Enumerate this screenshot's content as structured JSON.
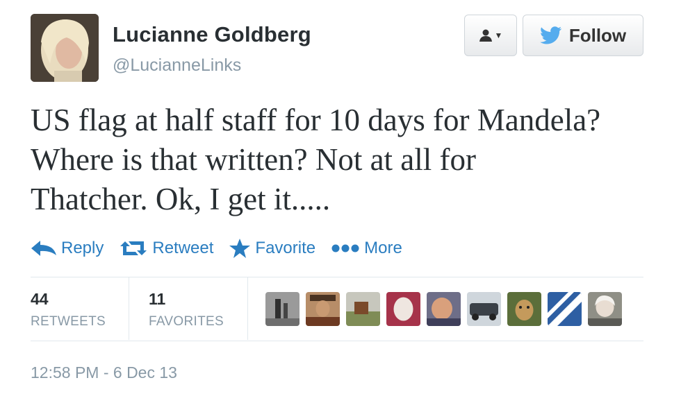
{
  "author": {
    "name": "Lucianne Goldberg",
    "handle": "@LucianneLinks"
  },
  "header": {
    "follow_label": "Follow"
  },
  "tweet": {
    "lines": [
      "US flag at half staff for 10 days for Mandela?",
      "Where is that written? Not at all for",
      "Thatcher. Ok, I get it....."
    ]
  },
  "actions": {
    "reply": "Reply",
    "retweet": "Retweet",
    "favorite": "Favorite",
    "more": "More"
  },
  "stats": {
    "retweets_count": "44",
    "retweets_label": "RETWEETS",
    "favorites_count": "11",
    "favorites_label": "FAVORITES"
  },
  "timestamp": "12:58 PM - 6 Dec 13",
  "colors": {
    "link_blue": "#2a7dc0",
    "twitter_blue": "#55acee",
    "muted_gray": "#8899a6"
  }
}
